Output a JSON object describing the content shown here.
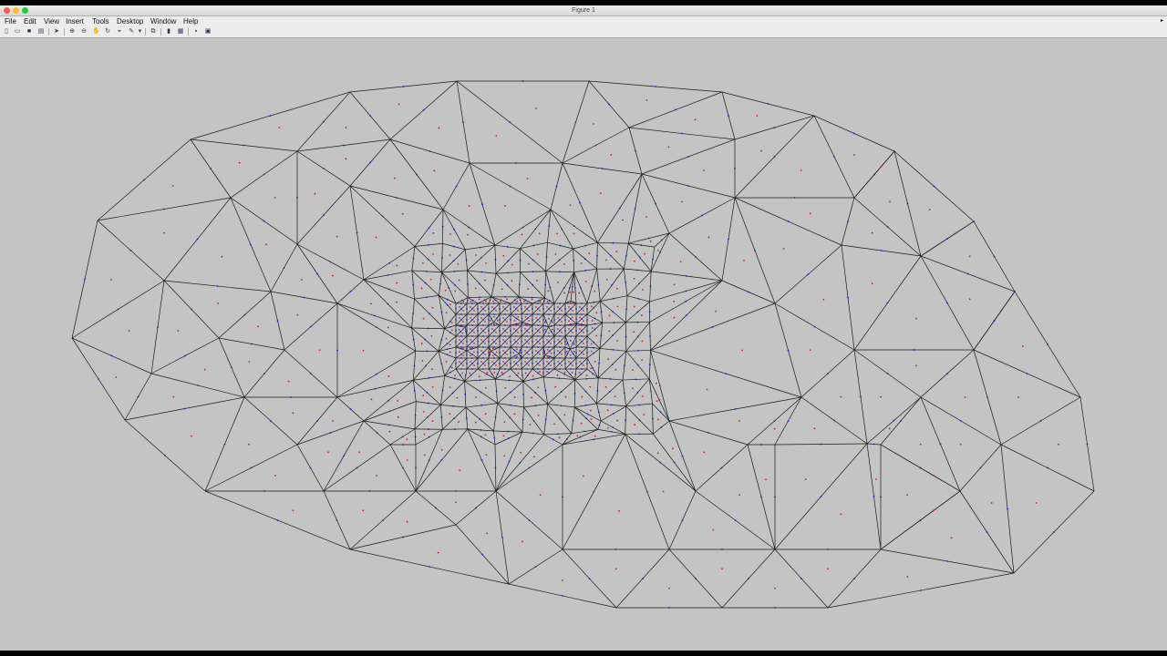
{
  "window": {
    "title": "Figure 1"
  },
  "menubar": {
    "items": [
      "File",
      "Edit",
      "View",
      "Insert",
      "Tools",
      "Desktop",
      "Window",
      "Help"
    ],
    "arrow": "▸"
  },
  "toolbar": {
    "icons": [
      "new-figure-icon",
      "open-file-icon",
      "save-icon",
      "print-icon",
      "pointer-icon",
      "zoom-in-icon",
      "zoom-out-icon",
      "pan-icon",
      "rotate-icon",
      "data-cursor-icon",
      "brush-icon",
      "link-icon",
      "colorbar-icon",
      "legend-icon",
      "hide-tools-icon",
      "show-tools-icon"
    ]
  },
  "colors": {
    "background": "#c4c4c4",
    "edge": "#1a1a1a",
    "node_blue": "#1c22c8",
    "centroid_red": "#c8201e"
  },
  "mesh": {
    "description_visible": false
  }
}
